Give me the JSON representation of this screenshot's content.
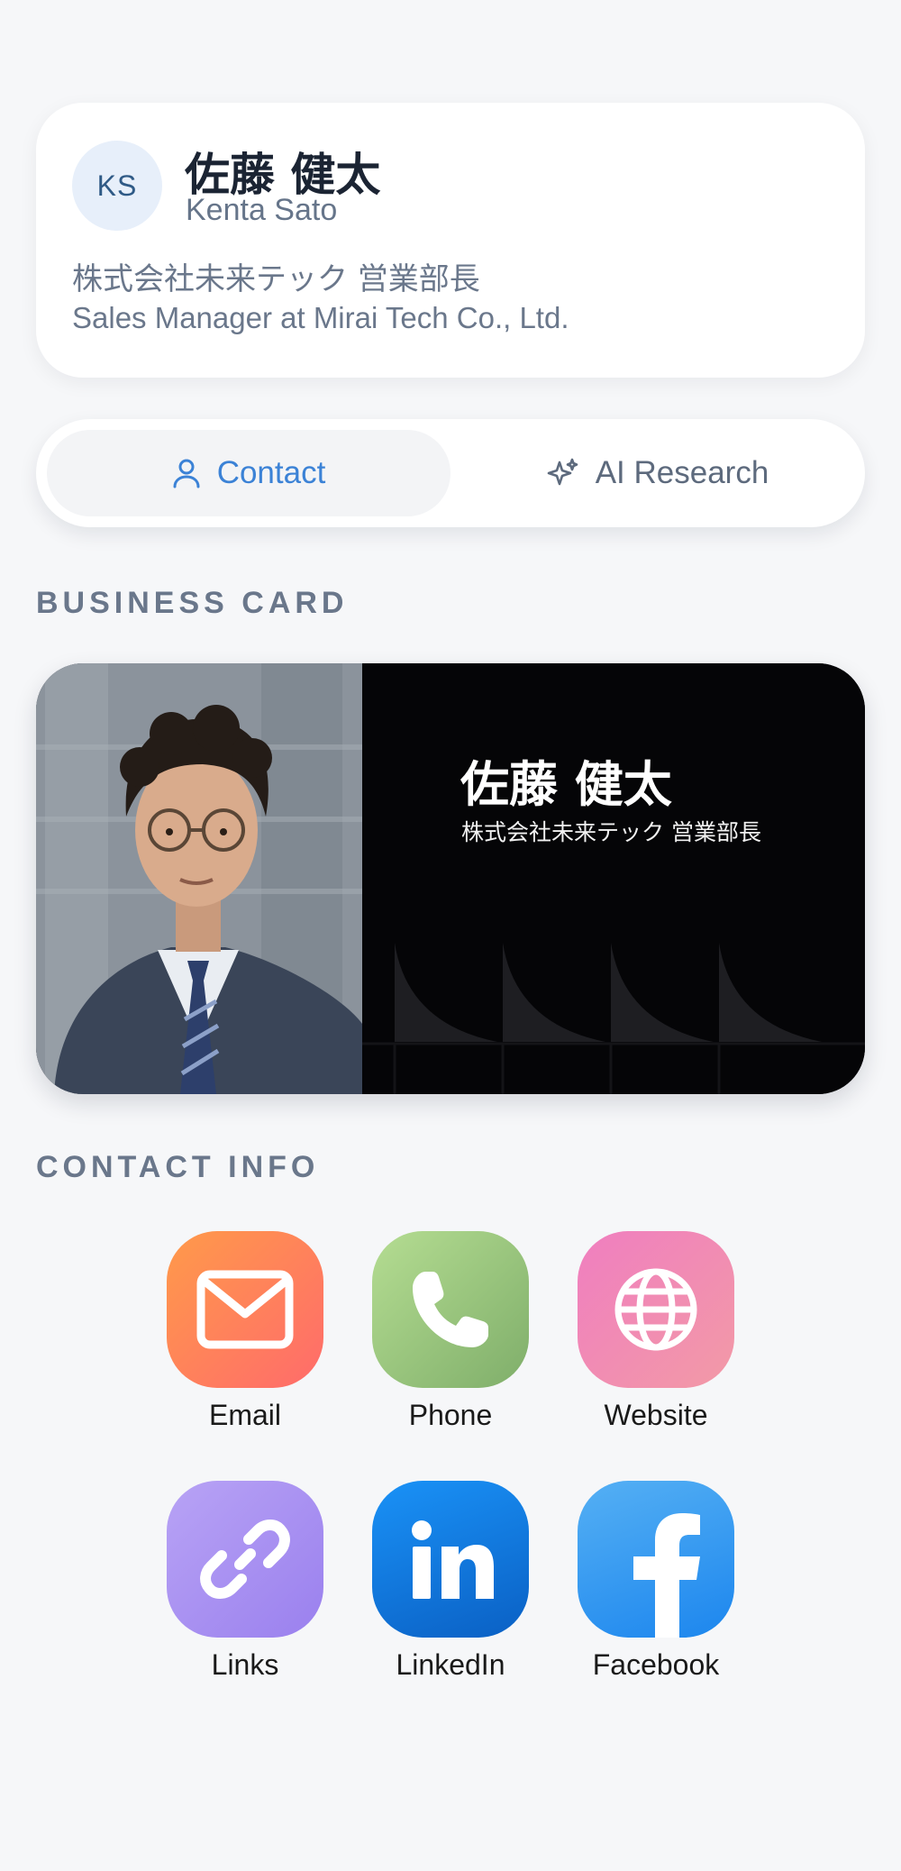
{
  "profile": {
    "initials": "KS",
    "name_jp": "佐藤 健太",
    "name_en": "Kenta Sato",
    "title_jp": "株式会社未来テック 営業部長",
    "title_en": "Sales Manager at Mirai Tech Co., Ltd."
  },
  "tabs": [
    {
      "label": "Contact",
      "icon": "person-icon",
      "active": true
    },
    {
      "label": "AI Research",
      "icon": "sparkles-icon",
      "active": false
    }
  ],
  "business_card": {
    "heading": "BUSINESS CARD",
    "name": "佐藤 健太",
    "title": "株式会社未来テック 営業部長"
  },
  "contact_info": {
    "heading": "CONTACT INFO",
    "items": [
      {
        "label": "Email",
        "icon": "mail-icon",
        "color_from": "#ff6b6b",
        "color_to": "#ff9a4a"
      },
      {
        "label": "Phone",
        "icon": "phone-icon",
        "color_from": "#a9d68a",
        "color_to": "#84b46f"
      },
      {
        "label": "Website",
        "icon": "globe-icon",
        "color_from": "#f07ec0",
        "color_to": "#f09aa8"
      },
      {
        "label": "Links",
        "icon": "link-icon",
        "color_from": "#b8a3f5",
        "color_to": "#9b82ef"
      },
      {
        "label": "LinkedIn",
        "icon": "linkedin-icon",
        "color_from": "#168ef5",
        "color_to": "#0a63c8"
      },
      {
        "label": "Facebook",
        "icon": "facebook-icon",
        "color_from": "#52adf3",
        "color_to": "#1e88ee"
      }
    ]
  },
  "colors": {
    "background": "#f6f7f9",
    "accent": "#3b82d6",
    "muted_text": "#6a778b"
  }
}
